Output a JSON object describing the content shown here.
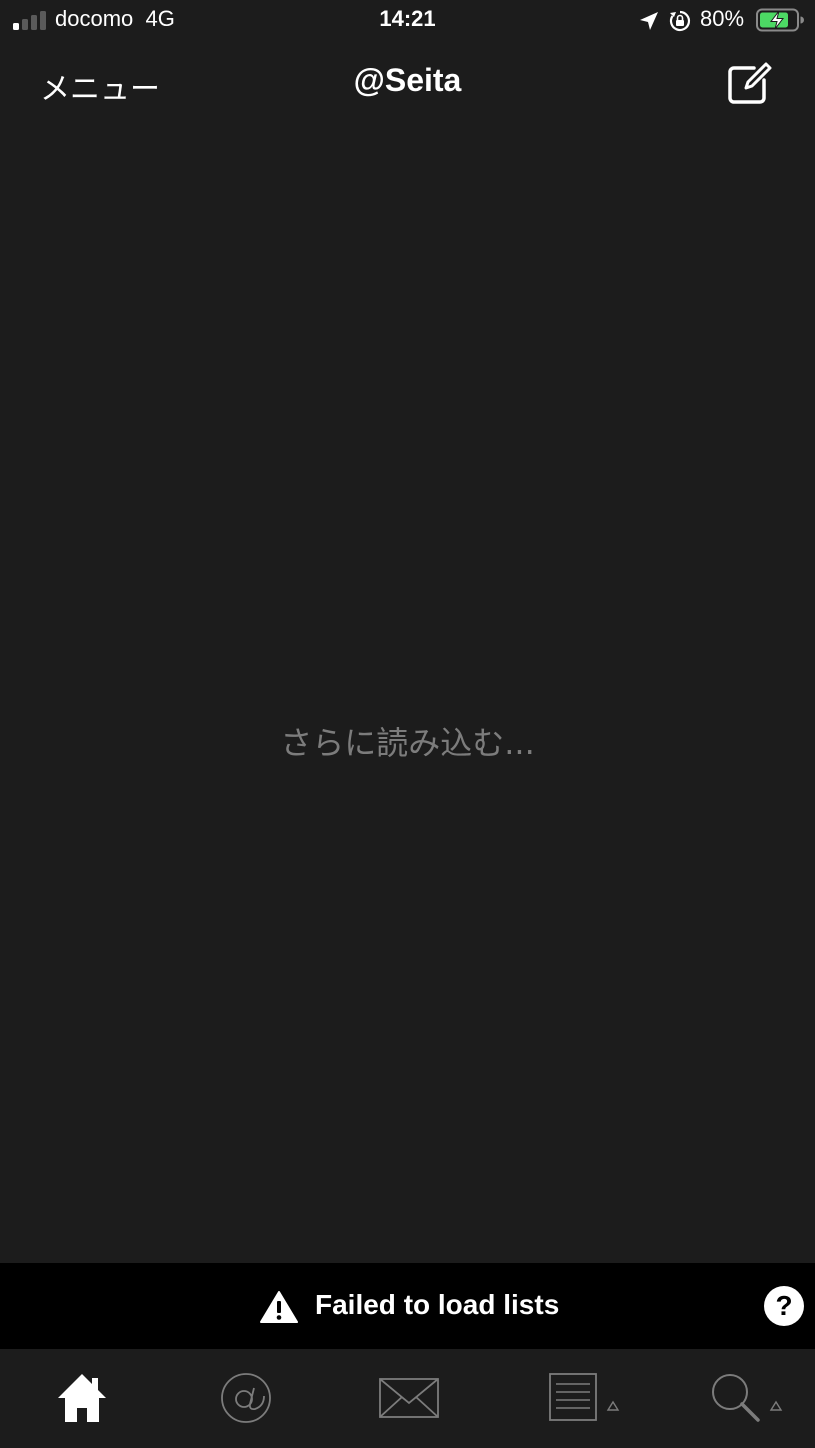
{
  "status_bar": {
    "carrier": "docomo",
    "network": "4G",
    "time": "14:21",
    "battery_percent": "80%",
    "battery_level": 0.8,
    "icons": [
      "signal-icon",
      "location-icon",
      "orientation-lock-icon",
      "battery-charging-icon"
    ]
  },
  "nav": {
    "menu_label": "メニュー",
    "title": "@Seita",
    "compose_icon": "compose-icon"
  },
  "content": {
    "load_more_label": "さらに読み込む..."
  },
  "error_banner": {
    "message": "Failed to load lists",
    "help_label": "?",
    "warning_icon": "warning-icon"
  },
  "tab_bar": {
    "tabs": [
      {
        "icon": "home-icon",
        "active": true
      },
      {
        "icon": "at-sign-icon",
        "active": false
      },
      {
        "icon": "envelope-icon",
        "active": false
      },
      {
        "icon": "list-icon",
        "active": false
      },
      {
        "icon": "search-icon",
        "active": false
      }
    ]
  },
  "colors": {
    "background": "#1c1c1c",
    "banner_background": "#000000",
    "text_primary": "#ffffff",
    "text_muted": "#7c7c7c",
    "battery_green": "#4cd964",
    "tab_inactive": "#7c7c7c"
  }
}
